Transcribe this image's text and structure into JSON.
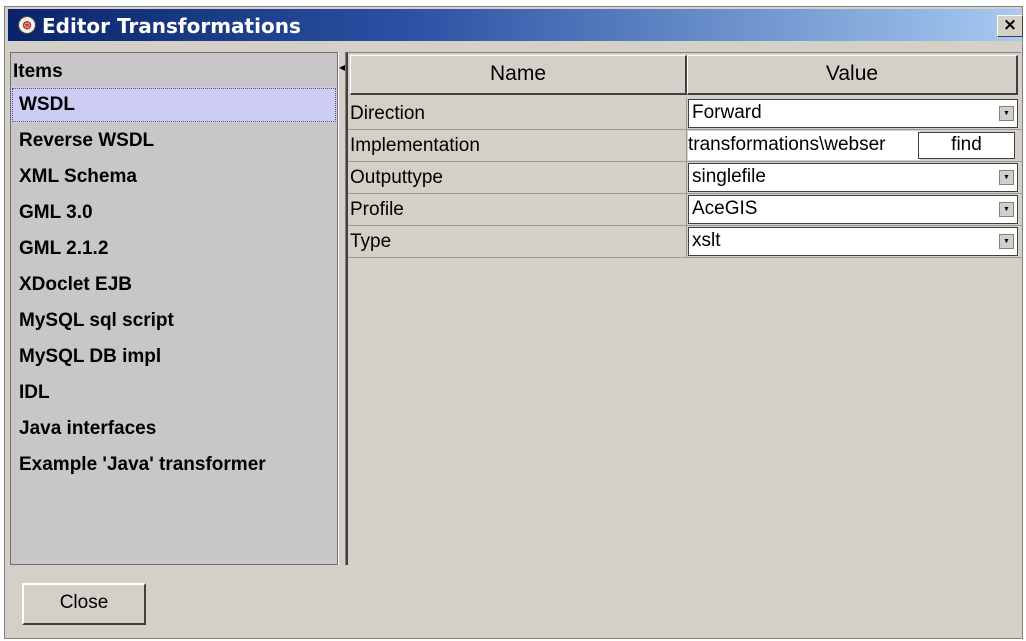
{
  "window": {
    "title": "Editor Transformations",
    "close_symbol": "×"
  },
  "items": {
    "header": "Items",
    "list": [
      {
        "label": "WSDL",
        "selected": true
      },
      {
        "label": "Reverse WSDL"
      },
      {
        "label": "XML Schema"
      },
      {
        "label": "GML 3.0"
      },
      {
        "label": "GML 2.1.2"
      },
      {
        "label": "XDoclet EJB"
      },
      {
        "label": "MySQL sql script"
      },
      {
        "label": "MySQL DB impl"
      },
      {
        "label": "IDL"
      },
      {
        "label": "Java interfaces"
      },
      {
        "label": "Example 'Java' transformer"
      }
    ]
  },
  "table": {
    "columns": [
      "Name",
      "Value"
    ],
    "rows": [
      {
        "name": "Direction",
        "value": "Forward",
        "kind": "combo"
      },
      {
        "name": "Implementation",
        "value": "transformations\\webser",
        "kind": "path",
        "button": "find"
      },
      {
        "name": "Outputtype",
        "value": "singlefile",
        "kind": "combo"
      },
      {
        "name": "Profile",
        "value": "AceGIS",
        "kind": "combo"
      },
      {
        "name": "Type",
        "value": "xslt",
        "kind": "combo"
      }
    ]
  },
  "footer": {
    "close_label": "Close"
  },
  "icons": {
    "title": "app-logo-icon",
    "combo": "dropdown-arrow-icon"
  },
  "colors": {
    "title_start": "#0a246a",
    "title_end": "#a6caf0",
    "selection": "#ccccf4",
    "panel": "#d4d0c8"
  }
}
